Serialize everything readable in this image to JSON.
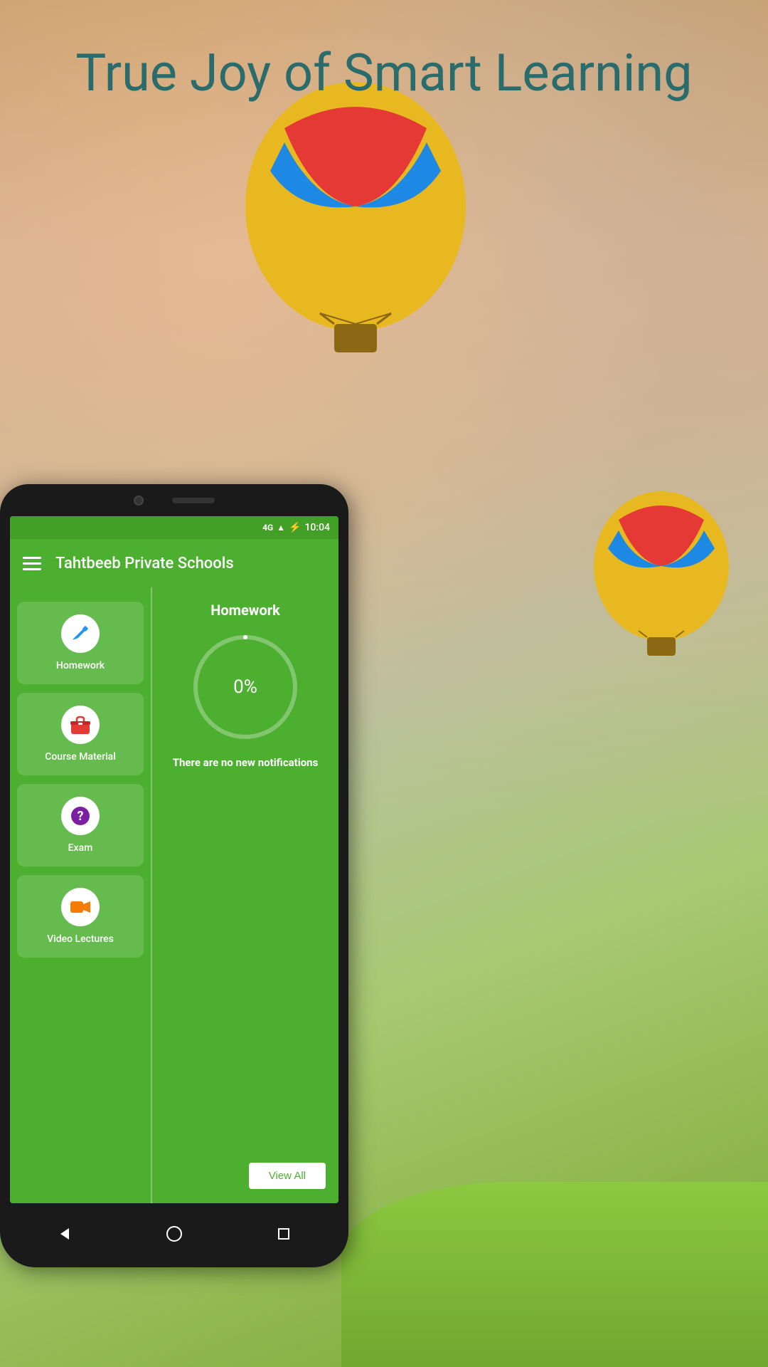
{
  "hero": {
    "title": "True Joy of Smart Learning"
  },
  "status_bar": {
    "network": "4G",
    "time": "10:04"
  },
  "app_bar": {
    "title": "Tahtbeeb Private Schools"
  },
  "nav_items": [
    {
      "id": "homework",
      "label": "Homework",
      "icon": "✏️",
      "icon_color": "#2196f3"
    },
    {
      "id": "course_material",
      "label": "Course Material",
      "icon": "🧳",
      "icon_color": "#e53935"
    },
    {
      "id": "exam",
      "label": "Exam",
      "icon": "❓",
      "icon_color": "#7b1fa2"
    },
    {
      "id": "video_lectures",
      "label": "Video Lectures",
      "icon": "📹",
      "icon_color": "#f57c00"
    }
  ],
  "homework_panel": {
    "title": "Homework",
    "progress_percent": "0%",
    "progress_value": 0,
    "notification": "There are no new notifications",
    "view_all_label": "View All"
  },
  "bottom_nav": {
    "back": "◀",
    "home": "●",
    "recent": "■"
  }
}
